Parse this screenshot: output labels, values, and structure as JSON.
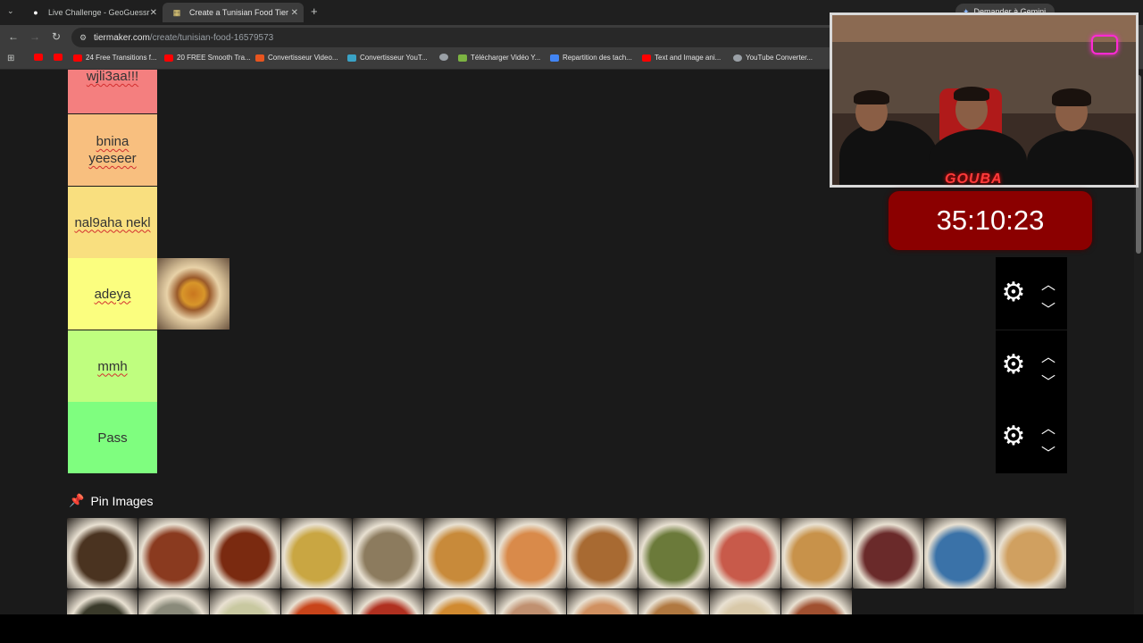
{
  "tabs": [
    {
      "title": "Live Challenge - GeoGuessr",
      "favicon": "location-pin-icon",
      "close": "✕"
    },
    {
      "title": "Create a Tunisian Food Tier List",
      "favicon": "tiermaker-icon",
      "close": "✕"
    }
  ],
  "new_tab": "+",
  "address": {
    "host": "tiermaker.com",
    "path": "/create/tunisian-food-16579573"
  },
  "gemini_button": "Demander à Gemini",
  "bookmarks": [
    {
      "label": "",
      "icon_color": "#ff0000"
    },
    {
      "label": "",
      "icon_color": "#ff0000"
    },
    {
      "label": "24 Free Transitions f...",
      "icon_color": "#ff0000"
    },
    {
      "label": "20 FREE Smooth Tra...",
      "icon_color": "#ff0000"
    },
    {
      "label": "Convertisseur Video...",
      "icon_color": "#e8551f"
    },
    {
      "label": "Convertisseur YouT...",
      "icon_color": "#3aa3c6"
    },
    {
      "label": "",
      "icon_color": "#9aa0a6"
    },
    {
      "label": "Télécharger Vidéo Y...",
      "icon_color": "#7cb342"
    },
    {
      "label": "Repartition des tach...",
      "icon_color": "#4285f4"
    },
    {
      "label": "Text and Image ani...",
      "icon_color": "#ff0000"
    },
    {
      "label": "YouTube Converter...",
      "icon_color": "#9aa0a6"
    }
  ],
  "tiers": [
    {
      "label": "wjli3aa!!!",
      "color": "#f47f7f",
      "underline": true
    },
    {
      "label": "bnina yeeseer",
      "color": "#f8bf7f",
      "underline": true
    },
    {
      "label": "nal9aha nekl",
      "color": "#f9df7f",
      "underline": true
    },
    {
      "label": "adeya",
      "color": "#fbfe7f",
      "underline": true,
      "items": [
        "couscous"
      ]
    },
    {
      "label": "mmh",
      "color": "#bffe7f",
      "underline": true
    },
    {
      "label": "Pass",
      "color": "#7ffe7f",
      "underline": false
    }
  ],
  "controls": {
    "gear": "⚙",
    "up": "⌃",
    "down": "⌄"
  },
  "pin_heading": "Pin Images",
  "pool_colors": [
    "#4a3320",
    "#8a3a1f",
    "#7a2a10",
    "#c9a642",
    "#8c7b5e",
    "#c88a3a",
    "#d98a4a",
    "#a86a32",
    "#6b7a3a",
    "#c85a4a",
    "#c8924a",
    "#6a2a2a",
    "#3a72a8",
    "#d0a060",
    "#3a3a2a",
    "#8a8a7a",
    "#c8c8a0",
    "#c8441a",
    "#b03020",
    "#d08a30",
    "#c09070",
    "#d09060",
    "#b07840",
    "#d8c8a8",
    "#a05030"
  ],
  "timer": "35:10:23",
  "overlay_brand": "GOUBA"
}
